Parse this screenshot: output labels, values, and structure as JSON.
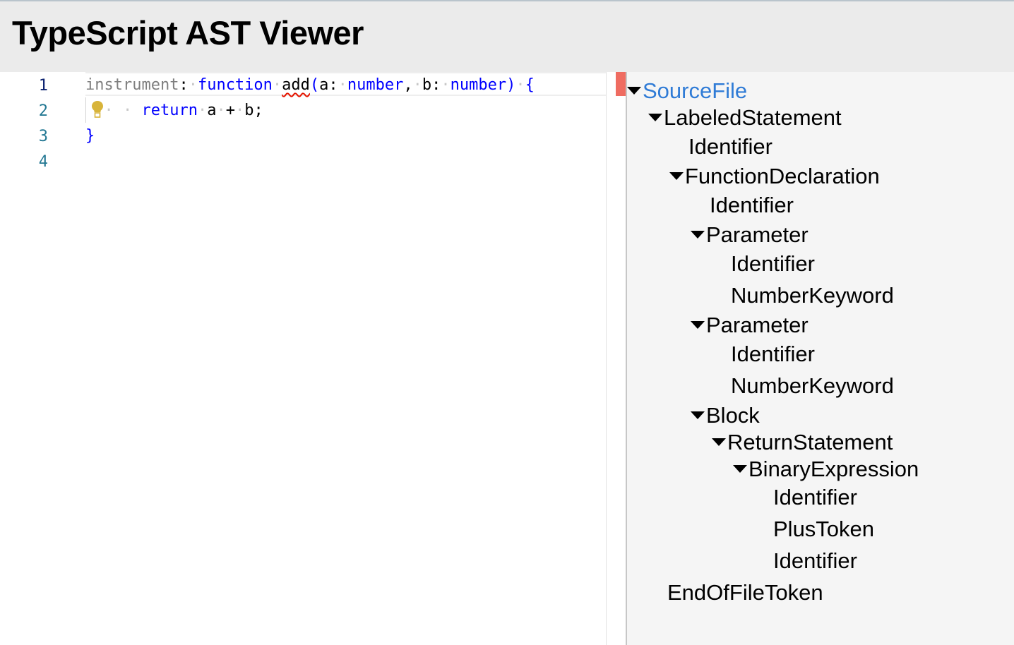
{
  "header": {
    "title": "TypeScript AST Viewer"
  },
  "editor": {
    "line_numbers": [
      "1",
      "2",
      "3",
      "4"
    ],
    "lines": {
      "l1": {
        "label": "instrument",
        "colon": ":",
        "kw_function": "function",
        "fn_name": "add",
        "paren_open": "(",
        "param_a": "a:",
        "type_a": "number",
        "comma": ",",
        "param_b": "b:",
        "type_b": "number",
        "paren_close": ")",
        "brace_open": "{"
      },
      "l2": {
        "kw_return": "return",
        "expr_a": "a",
        "op": "+",
        "expr_b": "b;"
      },
      "l3": {
        "brace_close": "}"
      }
    },
    "icons": {
      "lightbulb": "lightbulb-icon"
    },
    "colors": {
      "keyword": "#0000ff",
      "label": "#7f7f7f",
      "error_marker": "#ef6c61",
      "line_number": "#237893"
    }
  },
  "tree": {
    "nodes": [
      {
        "label": "SourceFile",
        "expanded": true,
        "selected": true
      },
      {
        "label": "LabeledStatement",
        "expanded": true
      },
      {
        "label": "Identifier"
      },
      {
        "label": "FunctionDeclaration",
        "expanded": true
      },
      {
        "label": "Identifier"
      },
      {
        "label": "Parameter",
        "expanded": true
      },
      {
        "label": "Identifier"
      },
      {
        "label": "NumberKeyword"
      },
      {
        "label": "Parameter",
        "expanded": true
      },
      {
        "label": "Identifier"
      },
      {
        "label": "NumberKeyword"
      },
      {
        "label": "Block",
        "expanded": true
      },
      {
        "label": "ReturnStatement",
        "expanded": true
      },
      {
        "label": "BinaryExpression",
        "expanded": true
      },
      {
        "label": "Identifier"
      },
      {
        "label": "PlusToken"
      },
      {
        "label": "Identifier"
      },
      {
        "label": "EndOfFileToken"
      }
    ],
    "colors": {
      "selected": "#2f7bd6"
    }
  }
}
